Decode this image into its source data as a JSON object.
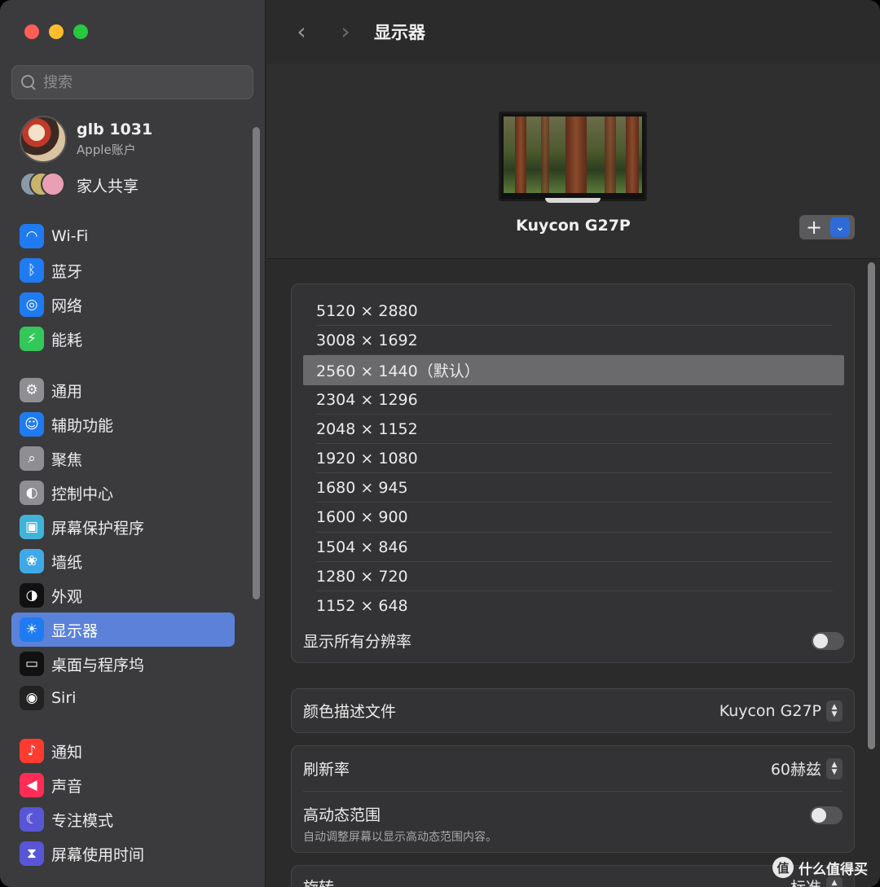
{
  "search": {
    "placeholder": "搜索"
  },
  "account": {
    "name": "glb 1031",
    "subtitle": "Apple账户"
  },
  "family": {
    "label": "家人共享"
  },
  "sidebar": {
    "groups": [
      [
        {
          "label": "Wi-Fi",
          "icon": "wifi-icon",
          "color": "#1f7bf2"
        },
        {
          "label": "蓝牙",
          "icon": "bluetooth-icon",
          "color": "#1f7bf2"
        },
        {
          "label": "网络",
          "icon": "globe-icon",
          "color": "#1f7bf2"
        },
        {
          "label": "能耗",
          "icon": "battery-bolt-icon",
          "color": "#34c759"
        }
      ],
      [
        {
          "label": "通用",
          "icon": "gear-icon",
          "color": "#8e8e93"
        },
        {
          "label": "辅助功能",
          "icon": "accessibility-icon",
          "color": "#1f7bf2"
        },
        {
          "label": "聚焦",
          "icon": "magnifier-icon",
          "color": "#8e8e93"
        },
        {
          "label": "控制中心",
          "icon": "switches-icon",
          "color": "#8e8e93"
        },
        {
          "label": "屏幕保护程序",
          "icon": "screensaver-icon",
          "color": "#3fb4d8"
        },
        {
          "label": "墙纸",
          "icon": "flower-icon",
          "color": "#3fa9e8"
        },
        {
          "label": "外观",
          "icon": "appearance-icon",
          "color": "#111111"
        },
        {
          "label": "显示器",
          "icon": "sun-icon",
          "color": "#1f7bf2",
          "active": true
        },
        {
          "label": "桌面与程序坞",
          "icon": "dock-icon",
          "color": "#111111"
        },
        {
          "label": "Siri",
          "icon": "siri-icon",
          "color": "#222222"
        }
      ],
      [
        {
          "label": "通知",
          "icon": "bell-icon",
          "color": "#ff3b30"
        },
        {
          "label": "声音",
          "icon": "speaker-icon",
          "color": "#ff2d55"
        },
        {
          "label": "专注模式",
          "icon": "moon-icon",
          "color": "#5856d6"
        },
        {
          "label": "屏幕使用时间",
          "icon": "hourglass-icon",
          "color": "#5856d6"
        }
      ]
    ]
  },
  "toolbar": {
    "title": "显示器"
  },
  "display": {
    "name": "Kuycon G27P"
  },
  "resolutions": {
    "items": [
      "5120 × 2880",
      "3008 × 1692",
      "2560 × 1440（默认）",
      "2304 × 1296",
      "2048 × 1152",
      "1920 × 1080",
      "1680 × 945",
      "1600 × 900",
      "1504 × 846",
      "1280 × 720",
      "1152 × 648"
    ],
    "selected_index": 2,
    "show_all_label": "显示所有分辨率",
    "show_all_on": false
  },
  "color_profile": {
    "label": "颜色描述文件",
    "value": "Kuycon G27P"
  },
  "refresh": {
    "label": "刷新率",
    "value": "60赫兹"
  },
  "hdr": {
    "label": "高动态范围",
    "sub": "自动调整屏幕以显示高动态范围内容。",
    "on": false
  },
  "rotation": {
    "label": "旋转",
    "value": "标准"
  },
  "watermark": {
    "icon_text": "值",
    "text": "什么值得买"
  }
}
